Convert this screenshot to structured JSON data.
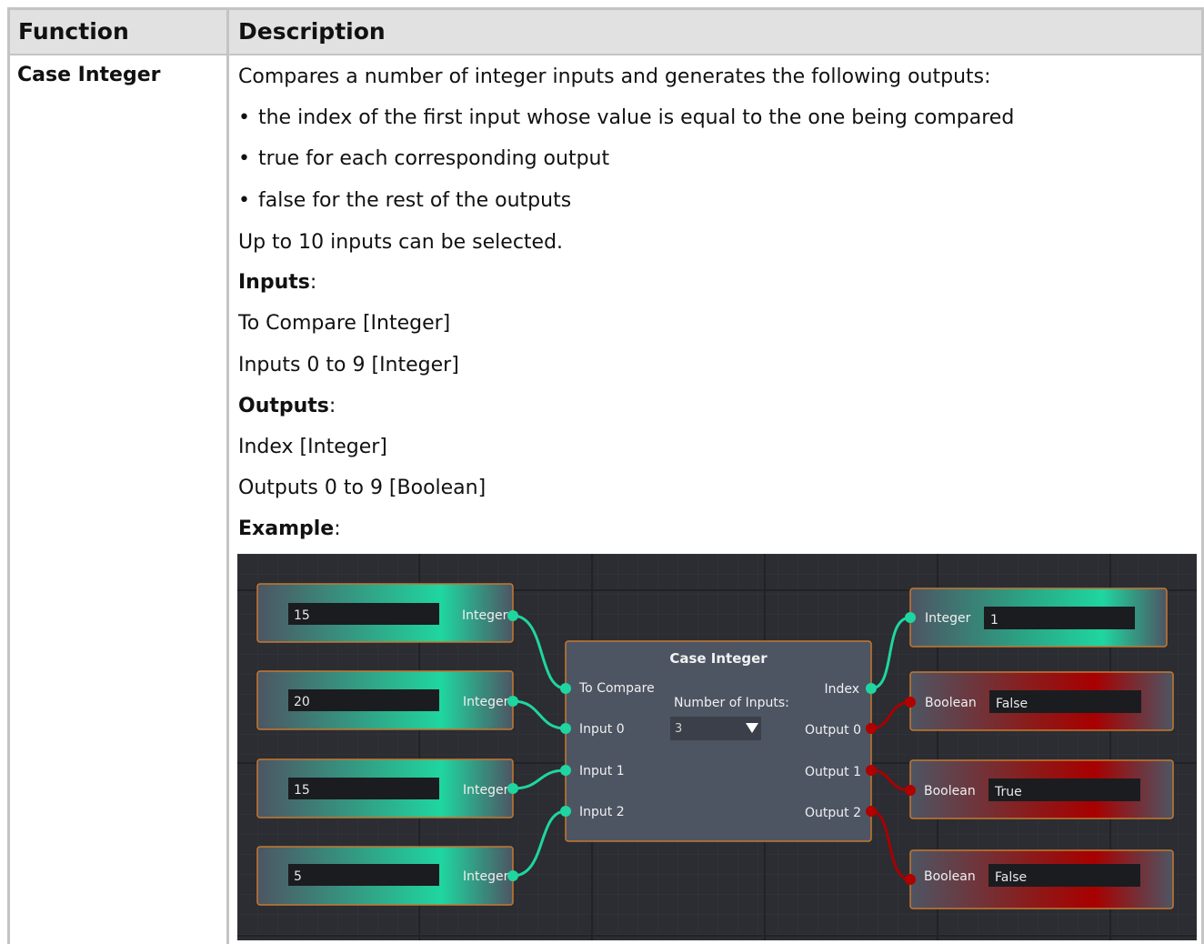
{
  "table": {
    "headers": [
      "Function",
      "Description"
    ],
    "function_name": "Case Integer",
    "intro": "Compares a number of integer inputs and generates the following outputs:",
    "bullets": [
      "the index of the first input whose value is equal to the one being compared",
      "true for each corresponding output",
      "false for the rest of the outputs"
    ],
    "note": "Up to 10 inputs can be selected.",
    "inputs_heading": "Inputs",
    "inputs": [
      "To Compare [Integer]",
      "Inputs 0 to 9 [Integer]"
    ],
    "outputs_heading": "Outputs",
    "outputs": [
      "Index [Integer]",
      "Outputs 0 to 9 [Boolean]"
    ],
    "example_heading": "Example",
    "colon": ":"
  },
  "example": {
    "input_nodes": [
      {
        "value": "15",
        "label": "Integer"
      },
      {
        "value": "20",
        "label": "Integer"
      },
      {
        "value": "15",
        "label": "Integer"
      },
      {
        "value": "5",
        "label": "Integer"
      }
    ],
    "case_node": {
      "title": "Case Integer",
      "to_compare_label": "To Compare",
      "input_labels": [
        "Input 0",
        "Input 1",
        "Input 2"
      ],
      "number_of_inputs_label": "Number of Inputs:",
      "number_of_inputs_value": "3",
      "index_label": "Index",
      "output_labels": [
        "Output 0",
        "Output 1",
        "Output 2"
      ]
    },
    "index_node": {
      "label": "Integer",
      "value": "1"
    },
    "boolean_nodes": [
      {
        "label": "Boolean",
        "value": "False"
      },
      {
        "label": "Boolean",
        "value": "True"
      },
      {
        "label": "Boolean",
        "value": "False"
      }
    ],
    "colors": {
      "canvas": "#2b2d32",
      "node": "#4d5563",
      "node_border": "#c7782e",
      "teal": "#1fd6a0",
      "red": "#b10000",
      "field": "#1b1c20"
    }
  }
}
